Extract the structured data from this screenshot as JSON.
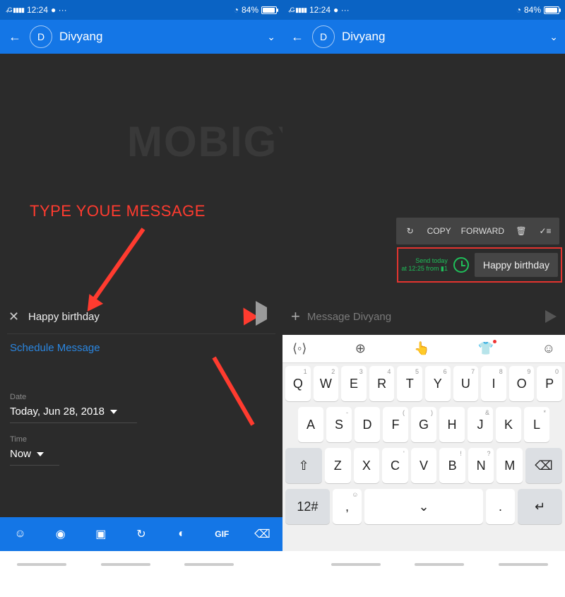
{
  "status": {
    "time": "12:24",
    "net": "⁴ᴳ",
    "battery_pct": "84%",
    "battery_fill_pct": 84
  },
  "header": {
    "avatar_letter": "D",
    "name": "Divyang"
  },
  "left": {
    "annotation": "TYPE YOUE MESSAGE",
    "input_text": "Happy birthday",
    "schedule_link": "Schedule Message",
    "date_label": "Date",
    "date_value": "Today, Jun 28, 2018",
    "time_label": "Time",
    "time_value": "Now",
    "bottom_icons": [
      "emoji",
      "camera",
      "image",
      "history",
      "contact",
      "gif",
      "backspace"
    ]
  },
  "right": {
    "context_menu": {
      "copy": "COPY",
      "forward": "FORWARD"
    },
    "send_info_l1": "Send today",
    "send_info_l2": "at 12:25 from",
    "sim": "1",
    "bubble_text": "Happy birthday",
    "placeholder": "Message Divyang"
  },
  "keyboard": {
    "row1": [
      [
        "Q",
        "1"
      ],
      [
        "W",
        "2"
      ],
      [
        "E",
        "3"
      ],
      [
        "R",
        "4"
      ],
      [
        "T",
        "5"
      ],
      [
        "Y",
        "6"
      ],
      [
        "U",
        "7"
      ],
      [
        "I",
        "8"
      ],
      [
        "O",
        "9"
      ],
      [
        "P",
        "0"
      ]
    ],
    "row2": [
      [
        "A",
        ""
      ],
      [
        "S",
        "-"
      ],
      [
        "D",
        ""
      ],
      [
        "F",
        "("
      ],
      [
        "G",
        ")"
      ],
      [
        "H",
        ""
      ],
      [
        "J",
        "&"
      ],
      [
        "K",
        ""
      ],
      [
        "L",
        "*"
      ]
    ],
    "row3": [
      [
        "Z",
        ""
      ],
      [
        "X",
        ""
      ],
      [
        "C",
        "'"
      ],
      [
        "V",
        ""
      ],
      [
        "B",
        "!"
      ],
      [
        "N",
        "?"
      ],
      [
        "M",
        ""
      ]
    ],
    "sym_key": "12#",
    "comma": ",",
    "period": "."
  },
  "watermark": "MOBIGYAAN"
}
